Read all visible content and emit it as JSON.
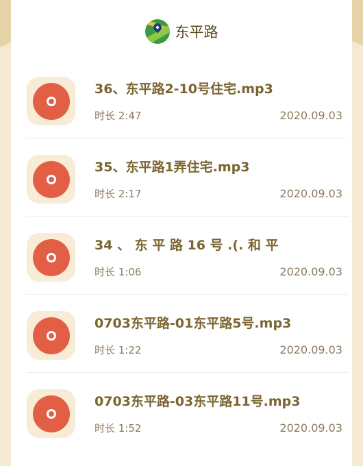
{
  "header": {
    "title": "东平路",
    "logo_icon": "map-pin-logo-icon"
  },
  "tracks": [
    {
      "title": "36、东平路2-10号住宅.mp3",
      "duration": "时长 2:47",
      "date": "2020.09.03"
    },
    {
      "title": "35、东平路1弄住宅.mp3",
      "duration": "时长 2:17",
      "date": "2020.09.03"
    },
    {
      "title": "34 、 东 平 路 16 号 .(. 和 平",
      "duration": "时长 1:06",
      "date": "2020.09.03"
    },
    {
      "title": "0703东平路-01东平路5号.mp3",
      "duration": "时长 1:22",
      "date": "2020.09.03"
    },
    {
      "title": "0703东平路-03东平路11号.mp3",
      "duration": "时长 1:52",
      "date": "2020.09.03"
    }
  ],
  "colors": {
    "disc": "#e25f46",
    "disc_bg": "#f8ecd6",
    "title": "#7a6530",
    "meta": "#8a7c5c",
    "page_bg": "#f3ead1"
  },
  "icons": {
    "track_icon": "audio-disc-icon"
  }
}
